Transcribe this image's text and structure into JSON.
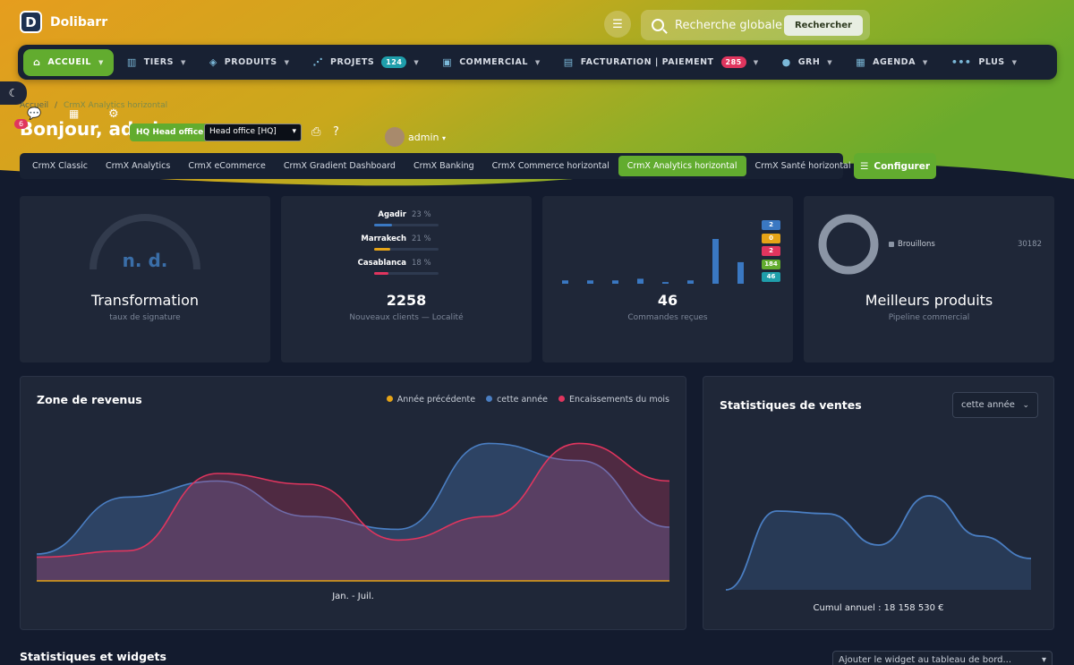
{
  "app": {
    "name": "Dolibarr",
    "logo_letter": "D"
  },
  "search": {
    "placeholder": "Recherche globale — c",
    "button": "Rechercher"
  },
  "nav": [
    {
      "label": "ACCUEIL",
      "icon": "home-icon",
      "active": true
    },
    {
      "label": "TIERS",
      "icon": "building-icon"
    },
    {
      "label": "PRODUITS",
      "icon": "box-icon"
    },
    {
      "label": "PROJETS",
      "icon": "project-icon",
      "badge": "124",
      "badge_color": "#1f9eab"
    },
    {
      "label": "COMMERCIAL",
      "icon": "briefcase-icon"
    },
    {
      "label": "FACTURATION | PAIEMENT",
      "icon": "invoice-icon",
      "badge": "285",
      "badge_color": "#e0355e"
    },
    {
      "label": "GRH",
      "icon": "user-icon"
    },
    {
      "label": "AGENDA",
      "icon": "calendar-icon"
    },
    {
      "label": "PLUS",
      "icon": "more-icon"
    }
  ],
  "breadcrumb": {
    "home": "Accueil",
    "sep": "/",
    "current": "CrmX Analytics horizontal"
  },
  "greeting": "Bonjour, admin",
  "quick_badge": "6",
  "hq_pill": "HQ Head office",
  "hq_select": "Head office [HQ]",
  "user": "admin",
  "tabs": [
    "CrmX Classic",
    "CrmX Analytics",
    "CrmX eCommerce",
    "CrmX Gradient Dashboard",
    "CrmX Banking",
    "CrmX Commerce horizontal",
    "CrmX Analytics horizontal",
    "CrmX Santé horizontal"
  ],
  "active_tab": 6,
  "configure": "Configurer",
  "cards": {
    "transformation": {
      "value": "n. d.",
      "title": "Transformation",
      "subtitle": "taux de signature"
    },
    "clients": {
      "title": "2258",
      "subtitle": "Nouveaux clients — Localité",
      "rows": [
        {
          "label": "Agadir",
          "pct": "23 %",
          "value": 23,
          "color": "#3a78c2"
        },
        {
          "label": "Marrakech",
          "pct": "21 %",
          "value": 21,
          "color": "#e6a417"
        },
        {
          "label": "Casablanca",
          "pct": "18 %",
          "value": 18,
          "color": "#e0355e"
        }
      ]
    },
    "orders": {
      "title": "46",
      "subtitle": "Commandes reçues",
      "bars": [
        2,
        2,
        2,
        3,
        1,
        2,
        27,
        13
      ],
      "stack_badges": [
        {
          "label": "2",
          "color": "#3a78c2"
        },
        {
          "label": "0",
          "color": "#e6a417"
        },
        {
          "label": "2",
          "color": "#e0355e"
        },
        {
          "label": "184",
          "color": "#62ac2f"
        },
        {
          "label": "46",
          "color": "#1f9eab"
        }
      ]
    },
    "products": {
      "title": "Meilleurs produits",
      "subtitle": "Pipeline commercial",
      "legend_label": "Brouillons",
      "legend_value": "30182"
    }
  },
  "revenue": {
    "title": "Zone de revenus",
    "legend": [
      {
        "name": "Année précédente",
        "color": "#e6a417"
      },
      {
        "name": "cette année",
        "color": "#4a7ec2"
      },
      {
        "name": "Encaissements du mois",
        "color": "#e0355e"
      }
    ],
    "xlabel": "Jan. - Juil."
  },
  "sales": {
    "title": "Statistiques de ventes",
    "period": "cette année",
    "footer": "Cumul annuel : 18 158 530 €"
  },
  "widgets": {
    "title": "Statistiques et widgets",
    "select": "Ajouter le widget au tableau de bord..."
  },
  "chart_data": [
    {
      "type": "area",
      "title": "Zone de revenus",
      "xlabel": "Jan. - Juil.",
      "ylim": [
        0,
        100
      ],
      "series": [
        {
          "name": "Année précédente",
          "values": [
            0,
            0,
            0,
            0,
            0,
            0,
            0,
            0
          ]
        },
        {
          "name": "cette année",
          "values": [
            25,
            78,
            93,
            60,
            48,
            128,
            112,
            50
          ]
        },
        {
          "name": "Encaissements du mois",
          "values": [
            22,
            28,
            100,
            90,
            38,
            60,
            128,
            93
          ]
        }
      ]
    },
    {
      "type": "area",
      "title": "Statistiques de ventes",
      "series": [
        {
          "values": [
            0,
            88,
            85,
            50,
            105,
            60,
            35
          ]
        }
      ]
    }
  ]
}
